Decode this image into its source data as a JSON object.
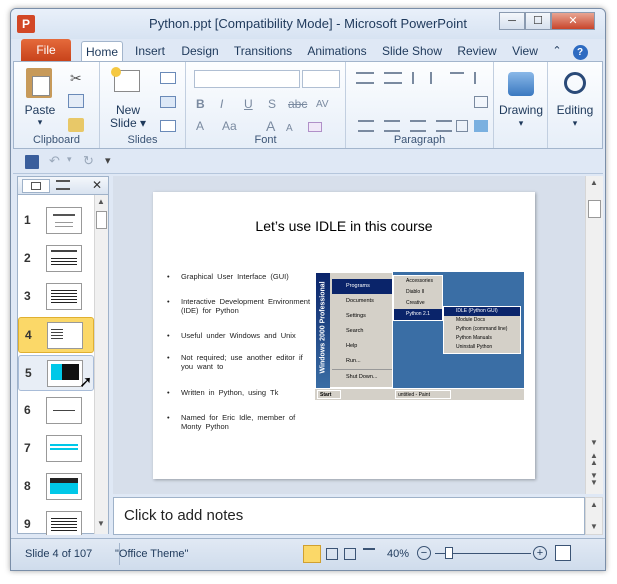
{
  "window": {
    "title": "Python.ppt [Compatibility Mode] - Microsoft PowerPoint",
    "app_icon": "P",
    "controls": [
      "─",
      "☐",
      "✕"
    ]
  },
  "tabs": [
    "File",
    "Home",
    "Insert",
    "Design",
    "Transitions",
    "Animations",
    "Slide Show",
    "Review",
    "View"
  ],
  "ribbon": {
    "paste": "Paste",
    "new_slide_1": "New",
    "new_slide_2": "Slide ▾",
    "drawing": "Drawing",
    "editing": "Editing",
    "groups": {
      "clipboard": "Clipboard",
      "slides": "Slides",
      "font": "Font",
      "paragraph": "Paragraph"
    },
    "font_buttons": [
      "B",
      "I",
      "U",
      "S",
      "abc",
      "AV",
      "A",
      "Aa",
      "A",
      "A"
    ]
  },
  "thumbnails": [
    "1",
    "2",
    "3",
    "4",
    "5",
    "6",
    "7",
    "8",
    "9"
  ],
  "slide": {
    "title": "Let’s use IDLE in this course",
    "bullets": [
      "Graphical User Interface (GUI)",
      "Interactive Development Environment (IDE) for Python",
      "Useful under Windows and Unix",
      "Not required; use another editor if you want to",
      "Written in Python, using Tk",
      "Named for Eric Idle, member of Monty Python"
    ],
    "bullet_symbol": "•",
    "screenshot": {
      "sidebar_text": "Windows 2000 Professional",
      "start_menu": [
        "Programs",
        "Documents",
        "Settings",
        "Search",
        "Help",
        "Run...",
        "Shut Down..."
      ],
      "programs": [
        "Accessories",
        "Diablo II",
        "Creative",
        "Python 2.1"
      ],
      "python_menu": [
        "IDLE (Python GUI)",
        "Module Docs",
        "Python (command line)",
        "Python Manuals",
        "Uninstall Python"
      ],
      "start_button": "Start",
      "task": "untitled - Paint"
    }
  },
  "notes": {
    "placeholder": "Click to add notes"
  },
  "status": {
    "slide": "Slide 4 of 107",
    "theme": "\"Office Theme\"",
    "zoom": "40%"
  },
  "colors": {
    "file_tab": "#d24726",
    "selected_thumb": "#fbd868",
    "desktop": "#3a6ea5"
  }
}
